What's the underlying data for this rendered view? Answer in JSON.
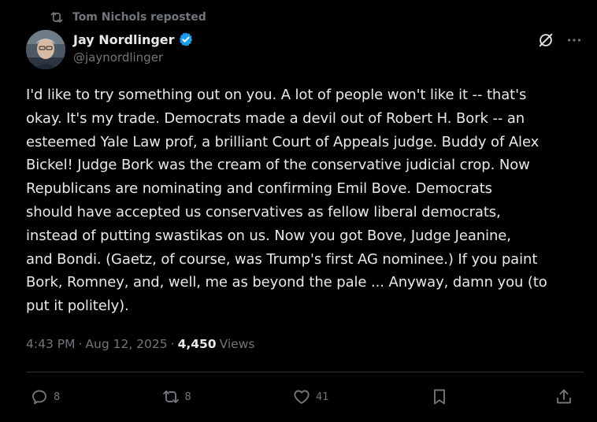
{
  "repost": {
    "label": "Tom Nichols reposted",
    "icon": "repost-icon"
  },
  "author": {
    "display_name": "Jay Nordlinger",
    "handle": "@jaynordlinger",
    "verified": true,
    "avatar_icon": "avatar"
  },
  "top_actions": {
    "grok_icon": "grok-icon",
    "more_icon": "more-icon"
  },
  "tweet": {
    "text": "I'd like to try something out on you. A lot of people won't like it -- that's\nokay. It's my trade. Democrats made a devil out of Robert H. Bork -- an\nesteemed Yale Law prof, a brilliant Court of Appeals judge. Buddy of Alex\nBickel! Judge Bork was the cream of the conservative judicial crop. Now\nRepublicans are nominating and confirming Emil Bove. Democrats\nshould have accepted us conservatives as fellow liberal democrats,\ninstead of putting swastikas on us. Now you got Bove, Judge Jeanine,\nand Bondi. (Gaetz, of course, was Trump's first AG nominee.) If you paint\nBork, Romney, and, well, me as beyond the pale ... Anyway, damn you (to\nput it politely).",
    "time": "4:43 PM",
    "date": "Aug 12, 2025",
    "separator": "·",
    "views_count": "4,450",
    "views_label": "Views"
  },
  "actions": {
    "replies": "8",
    "reposts": "8",
    "likes": "41"
  },
  "colors": {
    "background": "#000000",
    "text": "#e7e9ea",
    "muted": "#71767b",
    "divider": "#2f3336",
    "verified": "#1d9bf0"
  }
}
